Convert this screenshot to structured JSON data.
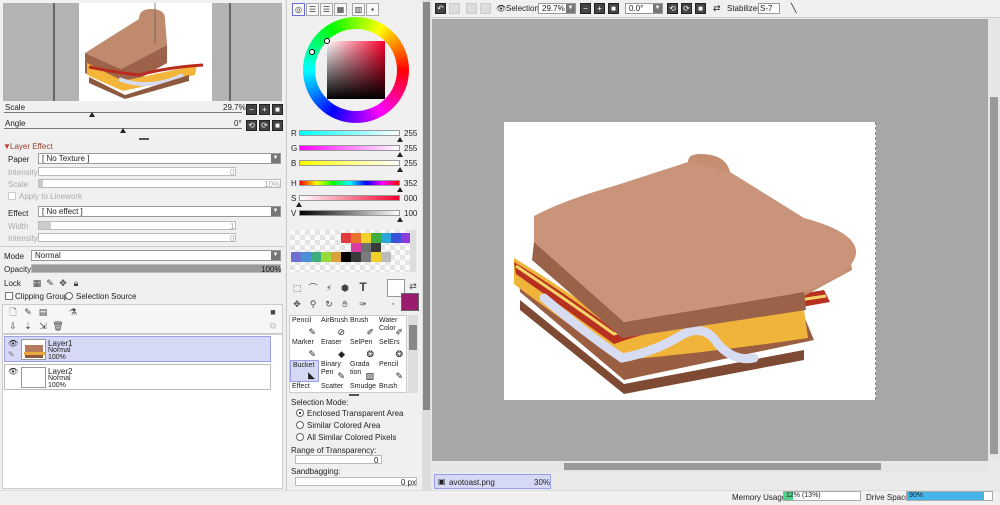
{
  "navigator": {
    "scale_label": "Scale",
    "scale_value": "29.7%",
    "angle_label": "Angle",
    "angle_value": "0°",
    "buttons": {
      "minus": "−",
      "plus": "+",
      "reset": "■",
      "rot_ccw": "⟲",
      "rot_cw": "⟳",
      "rot_reset": "■"
    }
  },
  "layer_effect": {
    "header": "Layer Effect",
    "paper_label": "Paper",
    "paper_value": "[ No Texture ]",
    "intensity_label": "Intensity",
    "intensity_value": "0",
    "scale_label": "Scale",
    "scale_value": "10%",
    "apply_linework": "Apply to Linework",
    "effect_label": "Effect",
    "effect_value": "[ No effect ]",
    "width_label": "Width",
    "width_value": "1",
    "intensity2_label": "Intensity",
    "intensity2_value": "0"
  },
  "layer_props": {
    "mode_label": "Mode",
    "mode_value": "Normal",
    "opacity_label": "Opacity",
    "opacity_value": "100%",
    "opacity_fraction": 1.0,
    "lock_label": "Lock",
    "clipping_group": "Clipping Group",
    "selection_source": "Selection Source"
  },
  "layers": [
    {
      "name": "Layer1",
      "mode": "Normal",
      "opacity": "100%",
      "selected": true
    },
    {
      "name": "Layer2",
      "mode": "Normal",
      "opacity": "100%",
      "selected": false
    }
  ],
  "color": {
    "r_label": "R",
    "r_value": "255",
    "g_label": "G",
    "g_value": "255",
    "b_label": "B",
    "b_value": "255",
    "h_label": "H",
    "h_value": "352",
    "s_label": "S",
    "s_value": "000",
    "v_label": "V",
    "v_value": "100",
    "primary": "#ffffff",
    "secondary": "#9b1b6e"
  },
  "palette": [
    "#e23b3b",
    "#e8732b",
    "#f0d12a",
    "#3fae3f",
    "#2aa6d9",
    "#3b52d9",
    "#8a3bd9",
    "#d93ba0",
    "#6f6f6f",
    "#3a3a3a",
    "#6f6fd0",
    "#4b8fd9",
    "#3fae7f",
    "#9ad93b",
    "#d9a03b",
    "#000000",
    "#3a3a3a",
    "#7a7a7a",
    "#f0d12a",
    "#bbbbbb"
  ],
  "tools": [
    {
      "label": "Pencil",
      "icon": "✎"
    },
    {
      "label": "AirBrush",
      "icon": "⊘"
    },
    {
      "label": "Brush",
      "icon": "✐"
    },
    {
      "label": "Water Color",
      "icon": "✐"
    },
    {
      "label": "Marker",
      "icon": "✎"
    },
    {
      "label": "Eraser",
      "icon": "◆"
    },
    {
      "label": "SelPen",
      "icon": "❂"
    },
    {
      "label": "SelErs",
      "icon": "❂"
    },
    {
      "label": "Bucket",
      "icon": "◣"
    },
    {
      "label": "Binary Pen",
      "icon": "✎"
    },
    {
      "label": "Grada tion",
      "icon": "▨"
    },
    {
      "label": "Pencil",
      "icon": "✎"
    },
    {
      "label": "Effect",
      "icon": ""
    },
    {
      "label": "Scatter",
      "icon": ""
    },
    {
      "label": "Smudge",
      "icon": ""
    },
    {
      "label": "Brush",
      "icon": ""
    }
  ],
  "tool_options": {
    "selection_mode_label": "Selection Mode:",
    "opt_enclosed": "Enclosed Transparent Area",
    "opt_similar": "Similar Colored Area",
    "opt_all_similar": "All Similar Colored Pixels",
    "range_label": "Range of Transparency:",
    "range_value": "0",
    "sandbagging_label": "Sandbagging:",
    "sandbagging_value": "0 px"
  },
  "toolbar": {
    "selection_label": "Selection",
    "zoom_value": "29.7%",
    "angle_value": "0.0°",
    "stabilizer_label": "Stabilizer",
    "stabilizer_value": "S-7"
  },
  "tab": {
    "filename": "avotoast.png",
    "zoom": "30%"
  },
  "status": {
    "memory_label": "Memory Usage",
    "memory_value": "12% (13%)",
    "memory_fraction": 0.12,
    "drive_label": "Drive Space",
    "drive_value": "90%",
    "drive_fraction": 0.9
  }
}
